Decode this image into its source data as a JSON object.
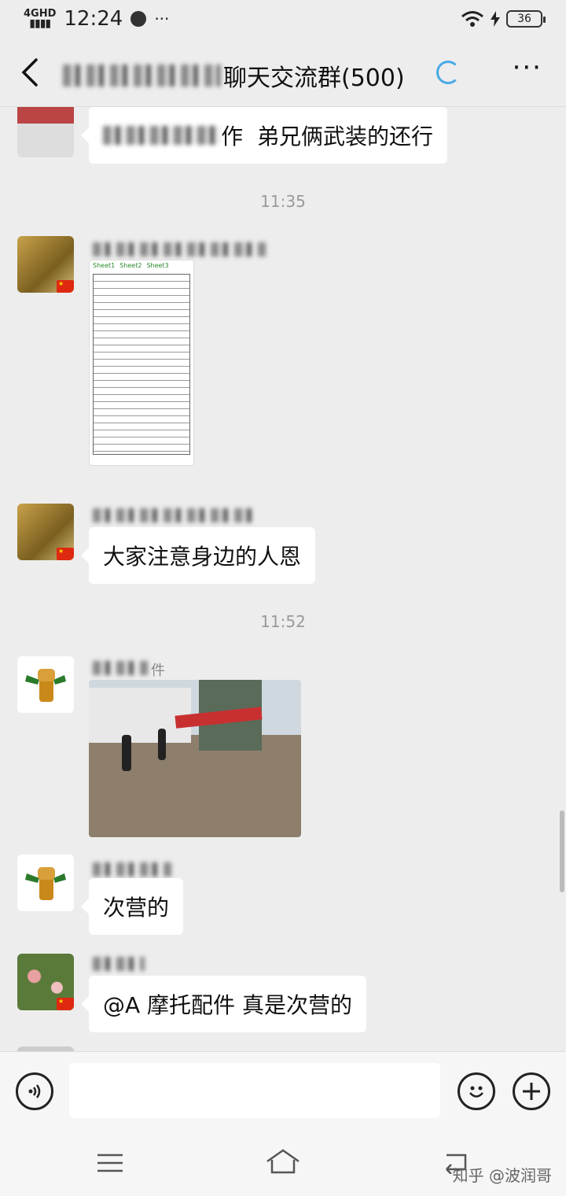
{
  "status": {
    "network": "4GHD",
    "time": "12:24",
    "dots": "···",
    "battery": "36"
  },
  "header": {
    "title_suffix": "聊天交流群(500)"
  },
  "chat": {
    "time_1": "11:35",
    "time_2": "11:52",
    "msg_1": "弟兄俩武装的还行",
    "msg_1_prefix": "作",
    "msg_3": "大家注意身边的人恩",
    "nick_4_suffix": "件",
    "msg_5": "次营的",
    "msg_6": "@A 摩托配件  真是次营的",
    "sheet_tabs": [
      "Sheet1",
      "Sheet2",
      "Sheet3"
    ]
  },
  "watermark": "知乎 @波润哥",
  "colors": {
    "background": "#ededed",
    "bubble": "#ffffff",
    "accent": "#4aa9e6"
  }
}
